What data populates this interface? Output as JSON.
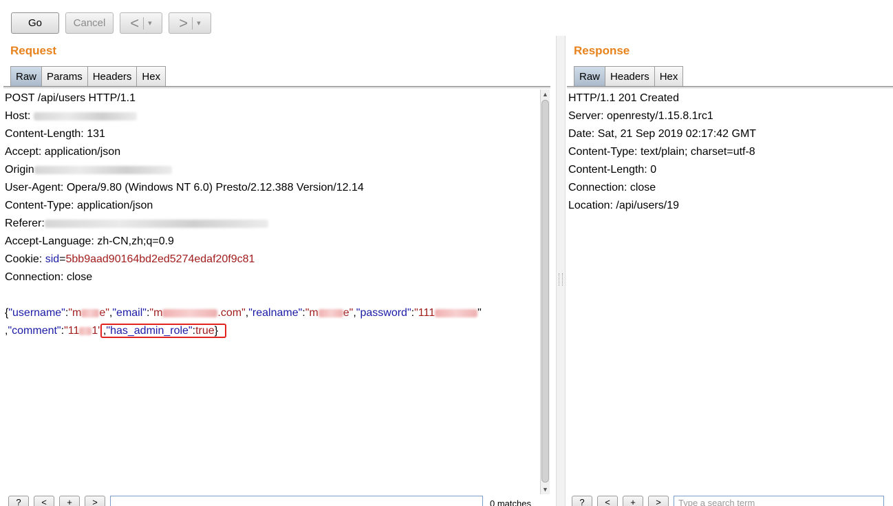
{
  "toolbar": {
    "go_label": "Go",
    "cancel_label": "Cancel",
    "back_label": "<",
    "forward_label": ">",
    "dropdown_glyph": "▾"
  },
  "request": {
    "title": "Request",
    "tabs": [
      "Raw",
      "Params",
      "Headers",
      "Hex"
    ],
    "lines": {
      "l1": "POST /api/users HTTP/1.1",
      "l2": "Host:",
      "l3": "Content-Length: 131",
      "l4": "Accept: application/json",
      "l5": "Origin",
      "l6": "User-Agent: Opera/9.80 (Windows NT 6.0) Presto/2.12.388 Version/12.14",
      "l7": "Content-Type: application/json",
      "l8": "Referer:",
      "l9": "Accept-Language: zh-CN,zh;q=0.9",
      "l10_prefix": "Cookie: ",
      "l10_key": "sid",
      "l10_eq": "=",
      "l10_val": "5bb9aad90164bd2ed5274edaf20f9c81",
      "l11": "Connection: close"
    },
    "body": {
      "open": "{",
      "username_key": "\"username\"",
      "username_val_a": "\"m",
      "username_val_b": "e\"",
      "email_key": "\"email\"",
      "email_val_a": "\"m",
      "email_val_b": ".com\"",
      "realname_key": "\"realname\"",
      "realname_val_a": "\"m",
      "realname_val_b": "e\"",
      "password_key": "\"password\"",
      "password_val_a": "\"111",
      "password_val_b": "\"",
      "comment_key": "\"comment\"",
      "comment_val_a": "\"11",
      "comment_val_b": "1\"",
      "admin_key": "\"has_admin_role\"",
      "admin_val": "true",
      "close": "}",
      "colon": ":",
      "comma": ","
    },
    "search": {
      "help_label": "?",
      "prev_label": "<",
      "add_label": "+",
      "next_label": ">",
      "placeholder": "",
      "matches": "0 matches"
    }
  },
  "response": {
    "title": "Response",
    "tabs": [
      "Raw",
      "Headers",
      "Hex"
    ],
    "lines": [
      "HTTP/1.1 201 Created",
      "Server: openresty/1.15.8.1rc1",
      "Date: Sat, 21 Sep 2019 02:17:42 GMT",
      "Content-Type: text/plain; charset=utf-8",
      "Content-Length: 0",
      "Connection: close",
      "Location: /api/users/19"
    ],
    "search": {
      "help_label": "?",
      "prev_label": "<",
      "add_label": "+",
      "next_label": ">",
      "placeholder": "Type a search term"
    }
  },
  "colors": {
    "title_orange": "#e8821c",
    "json_key": "#1a1aa6",
    "json_value": "#a11d1d",
    "highlight_red": "#e0231c"
  }
}
